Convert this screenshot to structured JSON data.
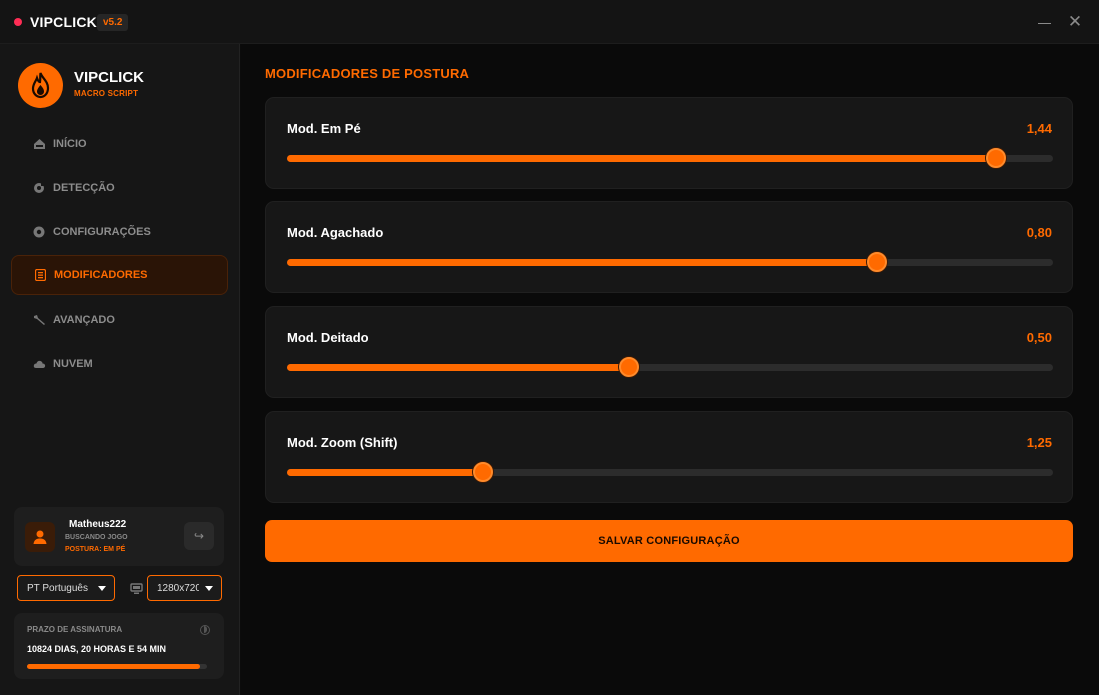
{
  "window": {
    "title": "VIPCLICK",
    "version": "v5.2"
  },
  "sidebar": {
    "brand": "VIPCLICK",
    "brand_sub": "MACRO SCRIPT",
    "items": [
      {
        "label": "INÍCIO",
        "icon": "home-icon",
        "active": false
      },
      {
        "label": "DETECÇÃO",
        "icon": "crosshair-icon",
        "active": false
      },
      {
        "label": "CONFIGURAÇÕES",
        "icon": "gear-icon",
        "active": false
      },
      {
        "label": "MODIFICADORES",
        "icon": "sliders-icon",
        "active": true
      },
      {
        "label": "AVANÇADO",
        "icon": "wrench-icon",
        "active": false
      },
      {
        "label": "NUVEM",
        "icon": "cloud-icon",
        "active": false
      }
    ],
    "user": {
      "name": "Matheus222",
      "status": "BUSCANDO JOGO",
      "posture": "POSTURA: EM PÉ"
    },
    "language_select": "PT Português",
    "resolution_select": "1280x720",
    "subscription": {
      "label": "PRAZO DE ASSINATURA",
      "time_left": "10824 DIAS, 20 HORAS E 54 MIN",
      "progress": 0.96
    }
  },
  "main": {
    "title": "MODIFICADORES DE POSTURA",
    "sliders": [
      {
        "label": "Mod. Em Pé",
        "value": "1,44",
        "fill": 0.926
      },
      {
        "label": "Mod. Agachado",
        "value": "0,80",
        "fill": 0.77
      },
      {
        "label": "Mod. Deitado",
        "value": "0,50",
        "fill": 0.446
      },
      {
        "label": "Mod. Zoom (Shift)",
        "value": "1,25",
        "fill": 0.256
      }
    ],
    "save_label": "SALVAR CONFIGURAÇÃO"
  },
  "colors": {
    "accent": "#ff6a00",
    "background": "#0a0a0a",
    "panel": "#171717"
  }
}
